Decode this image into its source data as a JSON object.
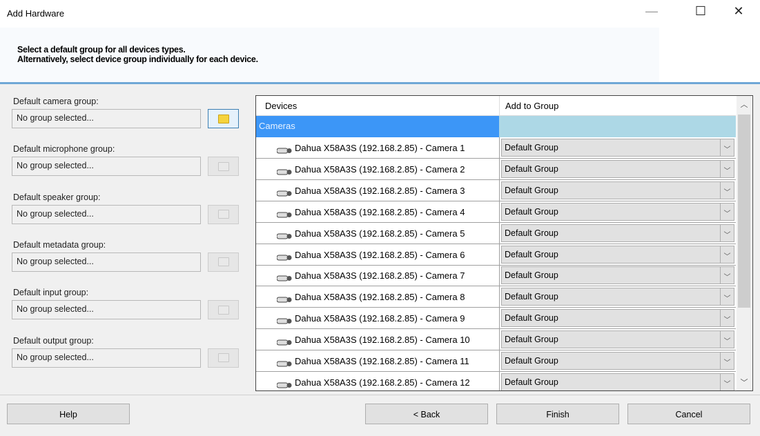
{
  "window": {
    "title": "Add Hardware",
    "minimize": "—",
    "maximize": "☐",
    "close": "✕"
  },
  "header": {
    "line1": "Select a default group for all devices types.",
    "line2": "Alternatively, select device group individually for each device."
  },
  "groups": [
    {
      "label": "Default camera group:",
      "value": "No group selected..."
    },
    {
      "label": "Default microphone group:",
      "value": "No group selected..."
    },
    {
      "label": "Default speaker group:",
      "value": "No group selected..."
    },
    {
      "label": "Default metadata group:",
      "value": "No group selected..."
    },
    {
      "label": "Default input group:",
      "value": "No group selected..."
    },
    {
      "label": "Default output group:",
      "value": "No group selected..."
    }
  ],
  "table": {
    "headers": [
      "Devices",
      "Add to Group"
    ],
    "category": "Cameras",
    "rows": [
      {
        "device": "Dahua X58A3S (192.168.2.85) - Camera 1",
        "group": "Default Group"
      },
      {
        "device": "Dahua X58A3S (192.168.2.85) - Camera 2",
        "group": "Default Group"
      },
      {
        "device": "Dahua X58A3S (192.168.2.85) - Camera 3",
        "group": "Default Group"
      },
      {
        "device": "Dahua X58A3S (192.168.2.85) - Camera 4",
        "group": "Default Group"
      },
      {
        "device": "Dahua X58A3S (192.168.2.85) - Camera 5",
        "group": "Default Group"
      },
      {
        "device": "Dahua X58A3S (192.168.2.85) - Camera 6",
        "group": "Default Group"
      },
      {
        "device": "Dahua X58A3S (192.168.2.85) - Camera 7",
        "group": "Default Group"
      },
      {
        "device": "Dahua X58A3S (192.168.2.85) - Camera 8",
        "group": "Default Group"
      },
      {
        "device": "Dahua X58A3S (192.168.2.85) - Camera 9",
        "group": "Default Group"
      },
      {
        "device": "Dahua X58A3S (192.168.2.85) - Camera 10",
        "group": "Default Group"
      },
      {
        "device": "Dahua X58A3S (192.168.2.85) - Camera 11",
        "group": "Default Group"
      },
      {
        "device": "Dahua X58A3S (192.168.2.85) - Camera 12",
        "group": "Default Group"
      }
    ]
  },
  "buttons": {
    "help": "Help",
    "back": "< Back",
    "finish": "Finish",
    "cancel": "Cancel"
  },
  "colors": {
    "selection": "#3c96f7",
    "group_header": "#add8e6",
    "folder_active": "#f5d33c"
  }
}
